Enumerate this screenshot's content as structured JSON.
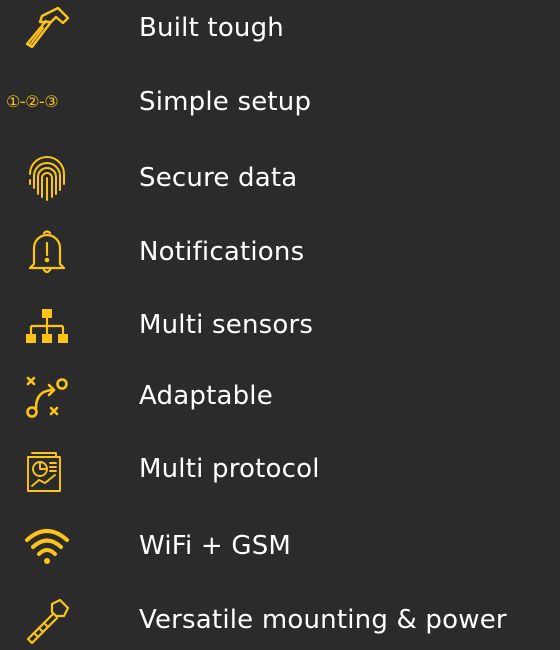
{
  "accent_color": "#fcc419",
  "background_color": "#2b2b2b",
  "features": [
    {
      "icon": "hammer-icon",
      "label": "Built tough"
    },
    {
      "icon": "steps-icon",
      "icon_text": "①-②-③",
      "label": "Simple setup"
    },
    {
      "icon": "fingerprint-icon",
      "label": "Secure data"
    },
    {
      "icon": "bell-alert-icon",
      "label": "Notifications"
    },
    {
      "icon": "network-tree-icon",
      "label": "Multi sensors"
    },
    {
      "icon": "route-icon",
      "label": "Adaptable"
    },
    {
      "icon": "document-chart-icon",
      "label": "Multi protocol"
    },
    {
      "icon": "wifi-icon",
      "label": "WiFi + GSM"
    },
    {
      "icon": "bolt-icon",
      "label": "Versatile mounting & power"
    }
  ]
}
